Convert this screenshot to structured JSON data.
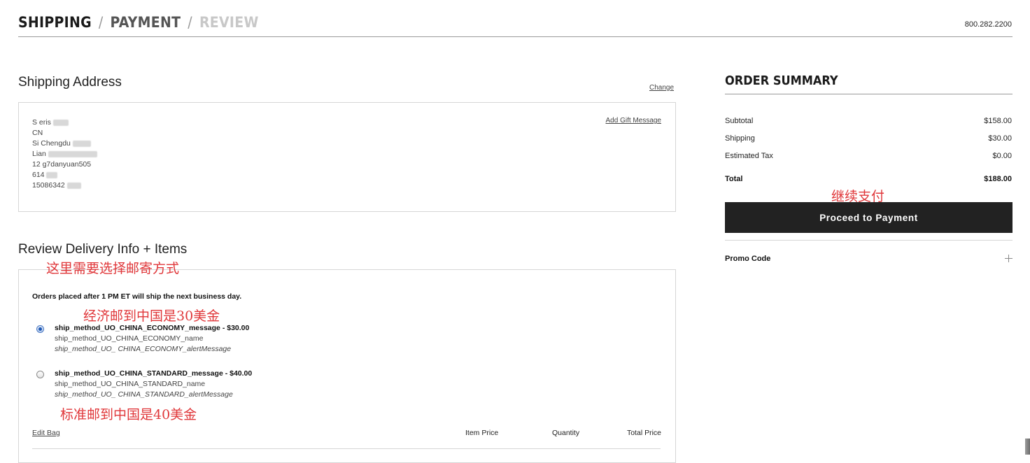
{
  "header": {
    "steps": [
      "SHIPPING",
      "PAYMENT",
      "REVIEW"
    ],
    "separator": "/",
    "phone": "800.282.2200"
  },
  "shipping_address": {
    "title": "Shipping Address",
    "change_link": "Change",
    "gift_link": "Add Gift Message",
    "lines": [
      "S eris",
      "CN",
      "Si Chengdu",
      "Lian",
      "12 g7danyuan505",
      "614",
      "15086342"
    ]
  },
  "delivery": {
    "title": "Review Delivery Info + Items",
    "notice": "Orders placed after 1 PM ET will ship the next business day.",
    "options": [
      {
        "message": "ship_method_UO_CHINA_ECONOMY_message - $30.00",
        "name": "ship_method_UO_CHINA_ECONOMY_name",
        "alert": "ship_method_UO_ CHINA_ECONOMY_alertMessage",
        "selected": true
      },
      {
        "message": "ship_method_UO_CHINA_STANDARD_message - $40.00",
        "name": "ship_method_UO_CHINA_STANDARD_name",
        "alert": "ship_method_UO_ CHINA_STANDARD_alertMessage",
        "selected": false
      }
    ],
    "edit_bag": "Edit Bag",
    "columns": [
      "Item Price",
      "Quantity",
      "Total Price"
    ]
  },
  "annotations": {
    "choose_method": "这里需要选择邮寄方式",
    "economy": "经济邮到中国是30美金",
    "standard": "标准邮到中国是40美金",
    "continue_pay": "继续支付"
  },
  "order_summary": {
    "title": "ORDER SUMMARY",
    "subtotal_label": "Subtotal",
    "subtotal": "$158.00",
    "shipping_label": "Shipping",
    "shipping": "$30.00",
    "tax_label": "Estimated Tax",
    "tax": "$0.00",
    "total_label": "Total",
    "total": "$188.00",
    "proceed_button": "Proceed to Payment",
    "promo_label": "Promo Code"
  },
  "icons": {
    "radio": "radio-button-icon",
    "expand": "plus-icon"
  },
  "colors": {
    "annotation": "#e0373a",
    "button_bg": "#222222",
    "radio_selected": "#1e57b3"
  }
}
